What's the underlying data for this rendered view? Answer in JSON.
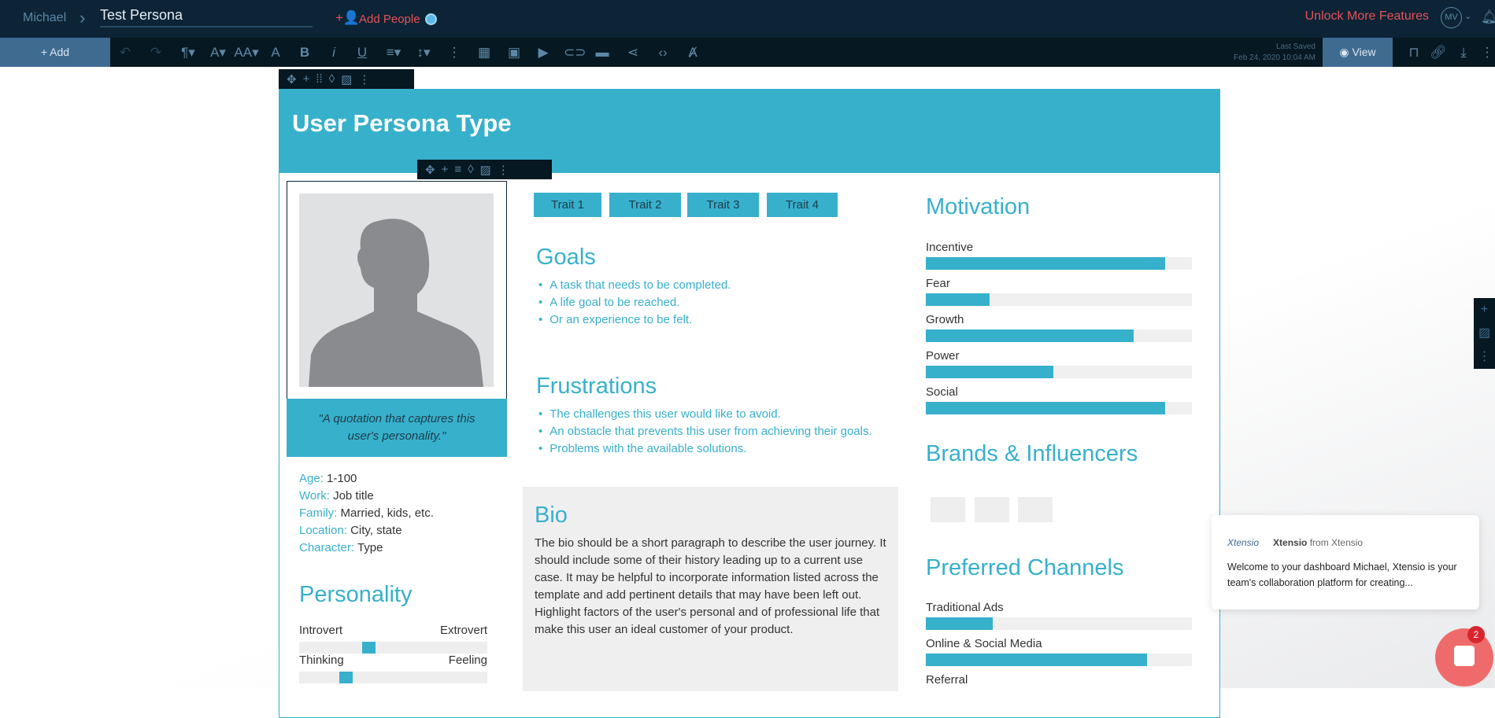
{
  "topbar": {
    "breadcrumb_parent": "Michael",
    "doc_title": "Test Persona",
    "add_people": "Add People",
    "unlock": "Unlock More Features",
    "avatar_initials": "MV"
  },
  "toolbar": {
    "add": "+ Add",
    "last_saved_label": "Last Saved",
    "last_saved_time": "Feb 24, 2020 10:04 AM",
    "view": "View"
  },
  "persona": {
    "title": "User Persona Type",
    "quote": "\"A quotation that captures this user's personality.\"",
    "details": [
      {
        "k": "Age:",
        "v": "1-100"
      },
      {
        "k": "Work:",
        "v": "Job title"
      },
      {
        "k": "Family:",
        "v": "Married, kids, etc."
      },
      {
        "k": "Location:",
        "v": "City, state"
      },
      {
        "k": "Character:",
        "v": "Type"
      }
    ],
    "personality": {
      "heading": "Personality",
      "sliders": [
        {
          "left": "Introvert",
          "right": "Extrovert",
          "value": 0.36
        },
        {
          "left": "Thinking",
          "right": "Feeling",
          "value": 0.23
        }
      ]
    },
    "traits": [
      "Trait 1",
      "Trait 2",
      "Trait 3",
      "Trait 4"
    ],
    "goals": {
      "heading": "Goals",
      "items": [
        "A task that needs to be completed.",
        "A life goal to be reached.",
        "Or an experience to be felt."
      ]
    },
    "frustrations": {
      "heading": "Frustrations",
      "items": [
        "The challenges this user would like to avoid.",
        "An obstacle that prevents this user from achieving their goals.",
        "Problems with the available solutions."
      ]
    },
    "bio": {
      "heading": "Bio",
      "text": "The bio should be a short paragraph to describe the user journey. It should include some of their history leading up to a current use case. It may be helpful to incorporate information listed across the template and add pertinent details that may have been left out. Highlight factors of the user's personal and of professional life that make this user an ideal customer of your product."
    },
    "motivation": {
      "heading": "Motivation",
      "items": [
        {
          "label": "Incentive",
          "value": 0.9
        },
        {
          "label": "Fear",
          "value": 0.24
        },
        {
          "label": "Growth",
          "value": 0.78
        },
        {
          "label": "Power",
          "value": 0.48
        },
        {
          "label": "Social",
          "value": 0.9
        }
      ]
    },
    "brands": {
      "heading": "Brands & Influencers"
    },
    "channels": {
      "heading": "Preferred Channels",
      "items": [
        {
          "label": "Traditional Ads",
          "value": 0.25
        },
        {
          "label": "Online & Social Media",
          "value": 0.83
        },
        {
          "label": "Referral"
        }
      ]
    }
  },
  "notification": {
    "logo": "Xtensio",
    "sender": "Xtensio",
    "from": "from Xtensio",
    "message": "Welcome to your dashboard Michael, Xtensio is your team's collaboration platform for creating..."
  },
  "chat": {
    "badge": "2"
  },
  "colors": {
    "accent": "#37b0cc",
    "topbar": "#0c2435",
    "toolbar": "#061821",
    "alert": "#e5525a"
  }
}
